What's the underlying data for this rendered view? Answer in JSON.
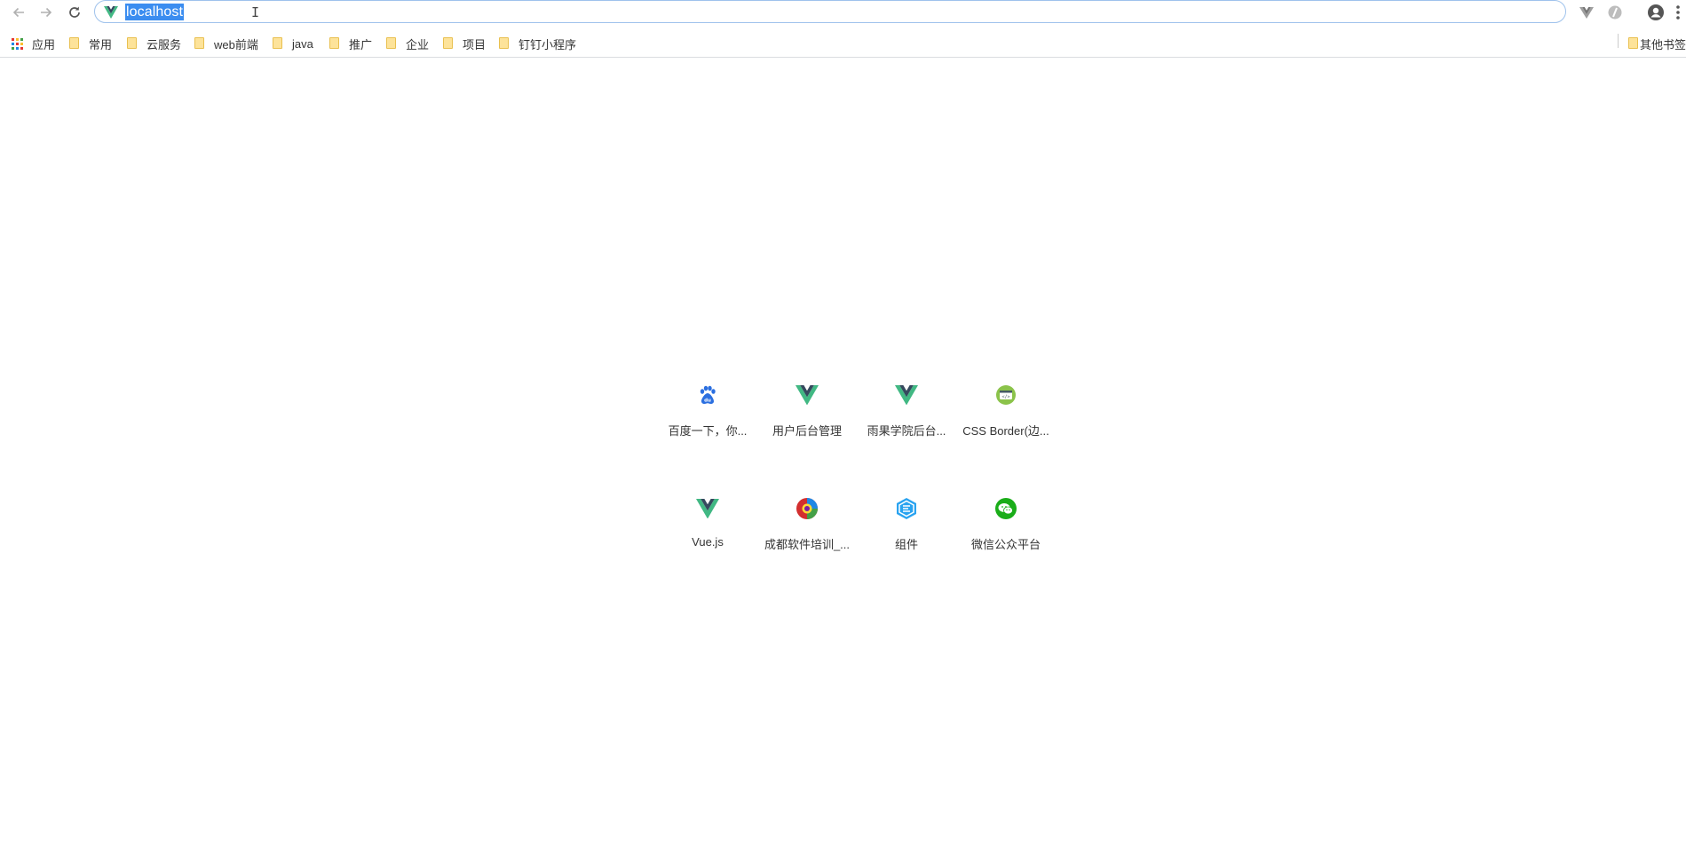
{
  "omnibox": {
    "url": "localhost",
    "site_icon": "vue-logo-icon"
  },
  "bookmarks": {
    "apps_label": "应用",
    "folders": [
      "常用",
      "云服务",
      "web前端",
      "java",
      "推广",
      "企业",
      "项目",
      "钉钉小程序"
    ],
    "other_label": "其他书签"
  },
  "tiles": [
    {
      "title": "百度一下，你...",
      "icon": "baidu-paw-icon"
    },
    {
      "title": "用户后台管理",
      "icon": "vue-logo-icon"
    },
    {
      "title": "雨果学院后台...",
      "icon": "vue-logo-icon"
    },
    {
      "title": "CSS Border(边...",
      "icon": "code-window-icon"
    },
    {
      "title": "Vue.js",
      "icon": "vue-logo-icon"
    },
    {
      "title": "成都软件培训_...",
      "icon": "colorful-circle-icon"
    },
    {
      "title": "组件",
      "icon": "blue-hexagon-icon"
    },
    {
      "title": "微信公众平台",
      "icon": "wechat-icon"
    }
  ],
  "colors": {
    "vue_green": "#41b883",
    "vue_dark": "#35495e",
    "url_highlight": "#3b8df0",
    "folder_yellow": "#fde39a"
  }
}
